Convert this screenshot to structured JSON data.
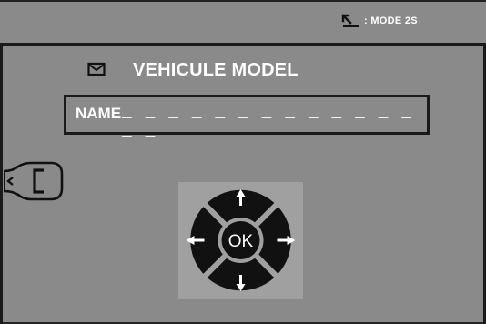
{
  "header": {
    "mode_icon": "back-arrow-icon",
    "mode_label": ": MODE 2S"
  },
  "screen": {
    "title_icon": "mail-icon",
    "title": "VEHICULE MODEL",
    "name_field": {
      "label": "NAME",
      "value": "_ _ _ _ _ _ _ _ _ _ _ _ _ _ _"
    }
  },
  "controls": {
    "back_button_icon": "back-bracket-icon",
    "dpad": {
      "ok_label": "OK",
      "up_icon": "arrow-up-icon",
      "down_icon": "arrow-down-icon",
      "left_icon": "arrow-left-icon",
      "right_icon": "arrow-right-icon"
    }
  },
  "colors": {
    "background": "#8a8a8a",
    "frame": "#1a1a1a",
    "text": "#ffffff",
    "dpad_panel": "#a0a0a0",
    "dpad_segment": "#111111"
  }
}
